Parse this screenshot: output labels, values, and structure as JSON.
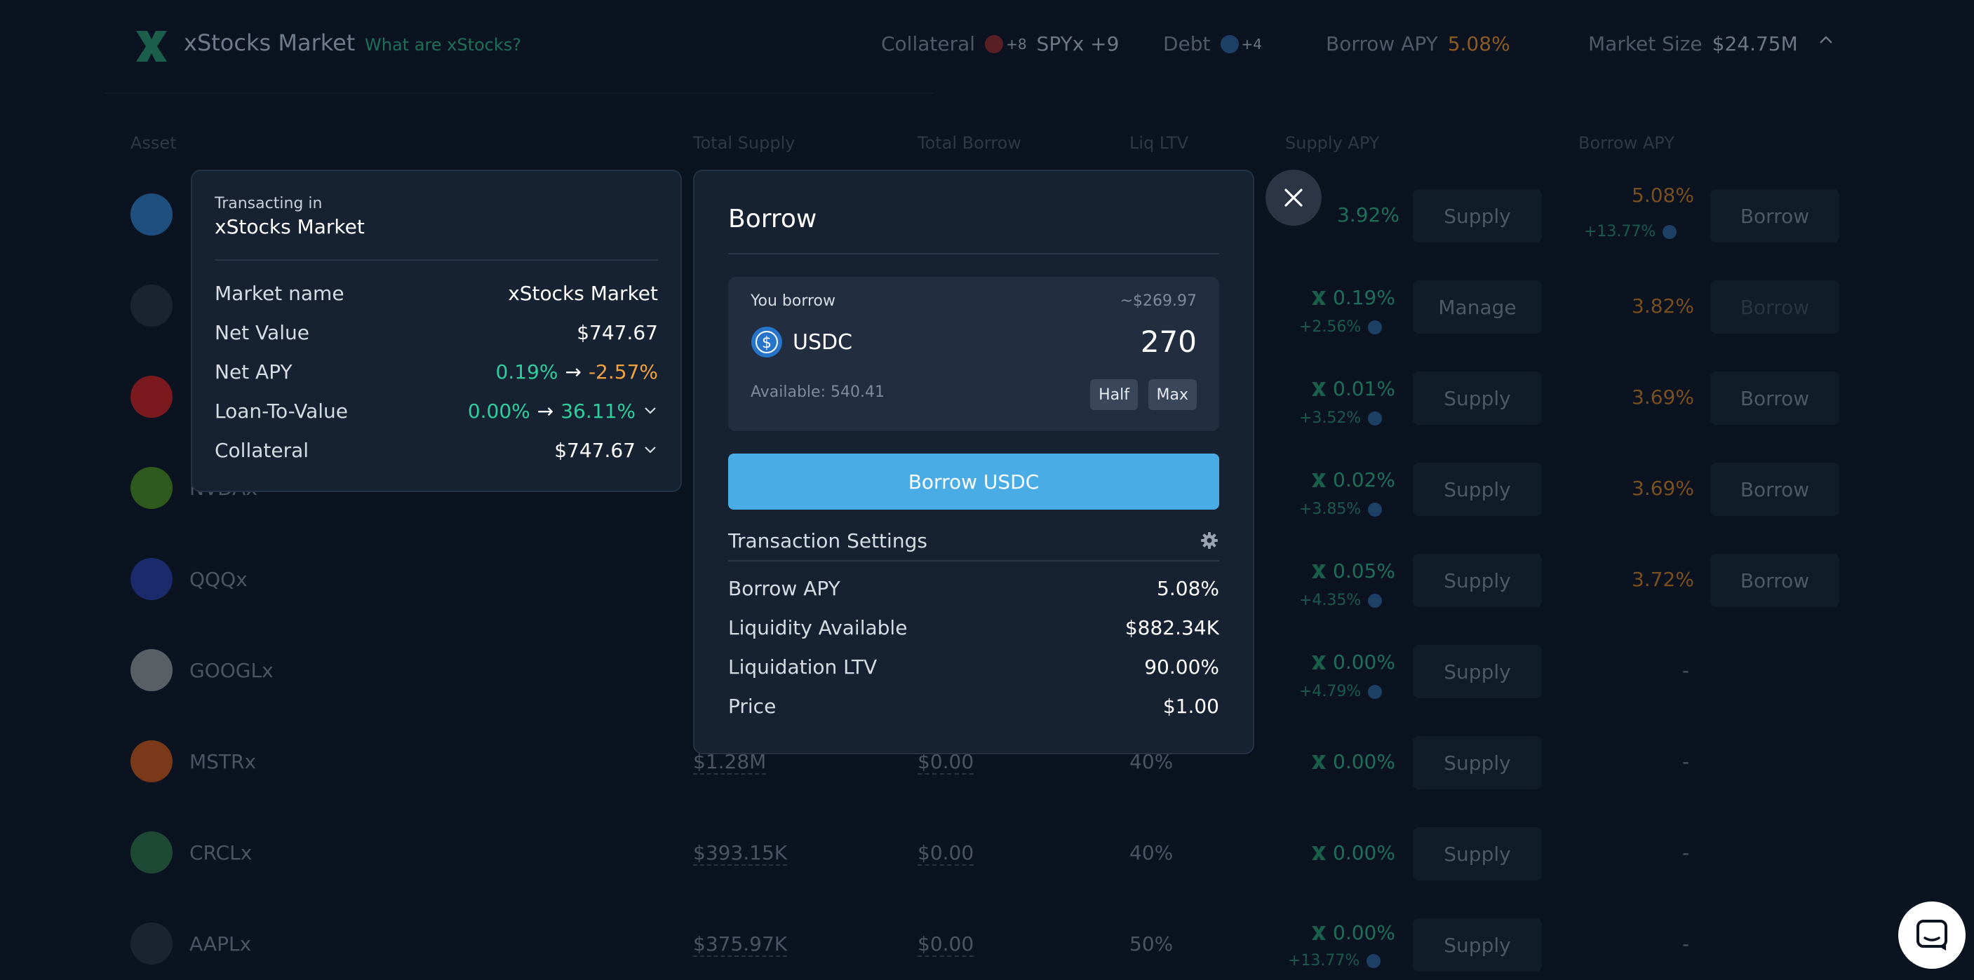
{
  "header": {
    "title": "xStocks Market",
    "what_link": "What are xStocks?",
    "collateral_label": "Collateral",
    "collateral_more": "+8",
    "collateral_main": "SPYx +9",
    "debt_label": "Debt",
    "debt_more": "+4",
    "borrow_apy_label": "Borrow APY",
    "borrow_apy_value": "5.08%",
    "market_size_label": "Market Size",
    "market_size_value": "$24.75M"
  },
  "table": {
    "columns": [
      "Asset",
      "Total Supply",
      "Total Borrow",
      "Liq LTV",
      "Supply APY",
      "Borrow APY"
    ],
    "rows": [
      {
        "asset": "",
        "supply_apy": "3.92%",
        "supply_btn": "Supply",
        "borrow_apy": "5.08%",
        "borrow_sub": "+13.77%",
        "borrow_btn": "Borrow",
        "icon_color": "#1f4f7e"
      },
      {
        "asset": "",
        "supply_apy": "0.19%",
        "supply_sub": "+2.56%",
        "supply_btn": "Manage",
        "borrow_apy": "3.82%",
        "borrow_btn": "Borrow",
        "icon_color": "#1a2330"
      },
      {
        "asset": "",
        "supply_apy": "0.01%",
        "supply_sub": "+3.52%",
        "supply_btn": "Supply",
        "borrow_apy": "3.69%",
        "borrow_btn": "Borrow",
        "icon_color": "#7a1a1f"
      },
      {
        "asset": "NVDAx",
        "supply_apy": "0.02%",
        "supply_sub": "+3.85%",
        "supply_btn": "Supply",
        "borrow_apy": "3.69%",
        "borrow_btn": "Borrow",
        "icon_color": "#2f5a1e"
      },
      {
        "asset": "QQQx",
        "supply_apy": "0.05%",
        "supply_sub": "+4.35%",
        "supply_btn": "Supply",
        "borrow_apy": "3.72%",
        "borrow_btn": "Borrow",
        "icon_color": "#1a2a6a"
      },
      {
        "asset": "GOOGLx",
        "supply_apy": "0.00%",
        "supply_sub": "+4.79%",
        "supply_btn": "Supply",
        "borrow_apy": "-",
        "icon_color": "#5a5f66"
      },
      {
        "asset": "MSTRx",
        "total_supply": "$1.28M",
        "total_borrow": "$0.00",
        "liq_ltv": "40%",
        "supply_apy": "0.00%",
        "supply_btn": "Supply",
        "borrow_apy": "-",
        "icon_color": "#7a3a1a"
      },
      {
        "asset": "CRCLx",
        "total_supply": "$393.15K",
        "total_borrow": "$0.00",
        "liq_ltv": "40%",
        "supply_apy": "0.00%",
        "supply_btn": "Supply",
        "borrow_apy": "-",
        "icon_color": "#1e4a35"
      },
      {
        "asset": "AAPLx",
        "total_supply": "$375.97K",
        "total_borrow": "$0.00",
        "liq_ltv": "50%",
        "supply_apy": "0.00%",
        "supply_sub": "+13.77%",
        "supply_btn": "Supply",
        "borrow_apy": "-",
        "icon_color": "#1a2330"
      }
    ]
  },
  "info_panel": {
    "label": "Transacting in",
    "market": "xStocks Market",
    "rows": {
      "market_name_k": "Market name",
      "market_name_v": "xStocks Market",
      "net_value_k": "Net Value",
      "net_value_v": "$747.67",
      "net_apy_k": "Net APY",
      "net_apy_from": "0.19%",
      "net_apy_to": "-2.57%",
      "ltv_k": "Loan-To-Value",
      "ltv_from": "0.00%",
      "ltv_to": "36.11%",
      "collateral_k": "Collateral",
      "collateral_v": "$747.67"
    },
    "arrow": "→"
  },
  "borrow_modal": {
    "title": "Borrow",
    "you_borrow": "You borrow",
    "usd_value": "~$269.97",
    "token": "USDC",
    "amount": "270",
    "available": "Available: 540.41",
    "half": "Half",
    "max": "Max",
    "action": "Borrow USDC",
    "settings": "Transaction Settings",
    "details": {
      "borrow_apy_k": "Borrow APY",
      "borrow_apy_v": "5.08%",
      "liquidity_k": "Liquidity Available",
      "liquidity_v": "$882.34K",
      "liq_ltv_k": "Liquidation LTV",
      "liq_ltv_v": "90.00%",
      "price_k": "Price",
      "price_v": "$1.00"
    }
  },
  "colors": {
    "accent_blue": "#4aace5",
    "green": "#2ecf9c",
    "orange": "#f2a33a",
    "background": "#0b1321",
    "panel": "#162131"
  }
}
